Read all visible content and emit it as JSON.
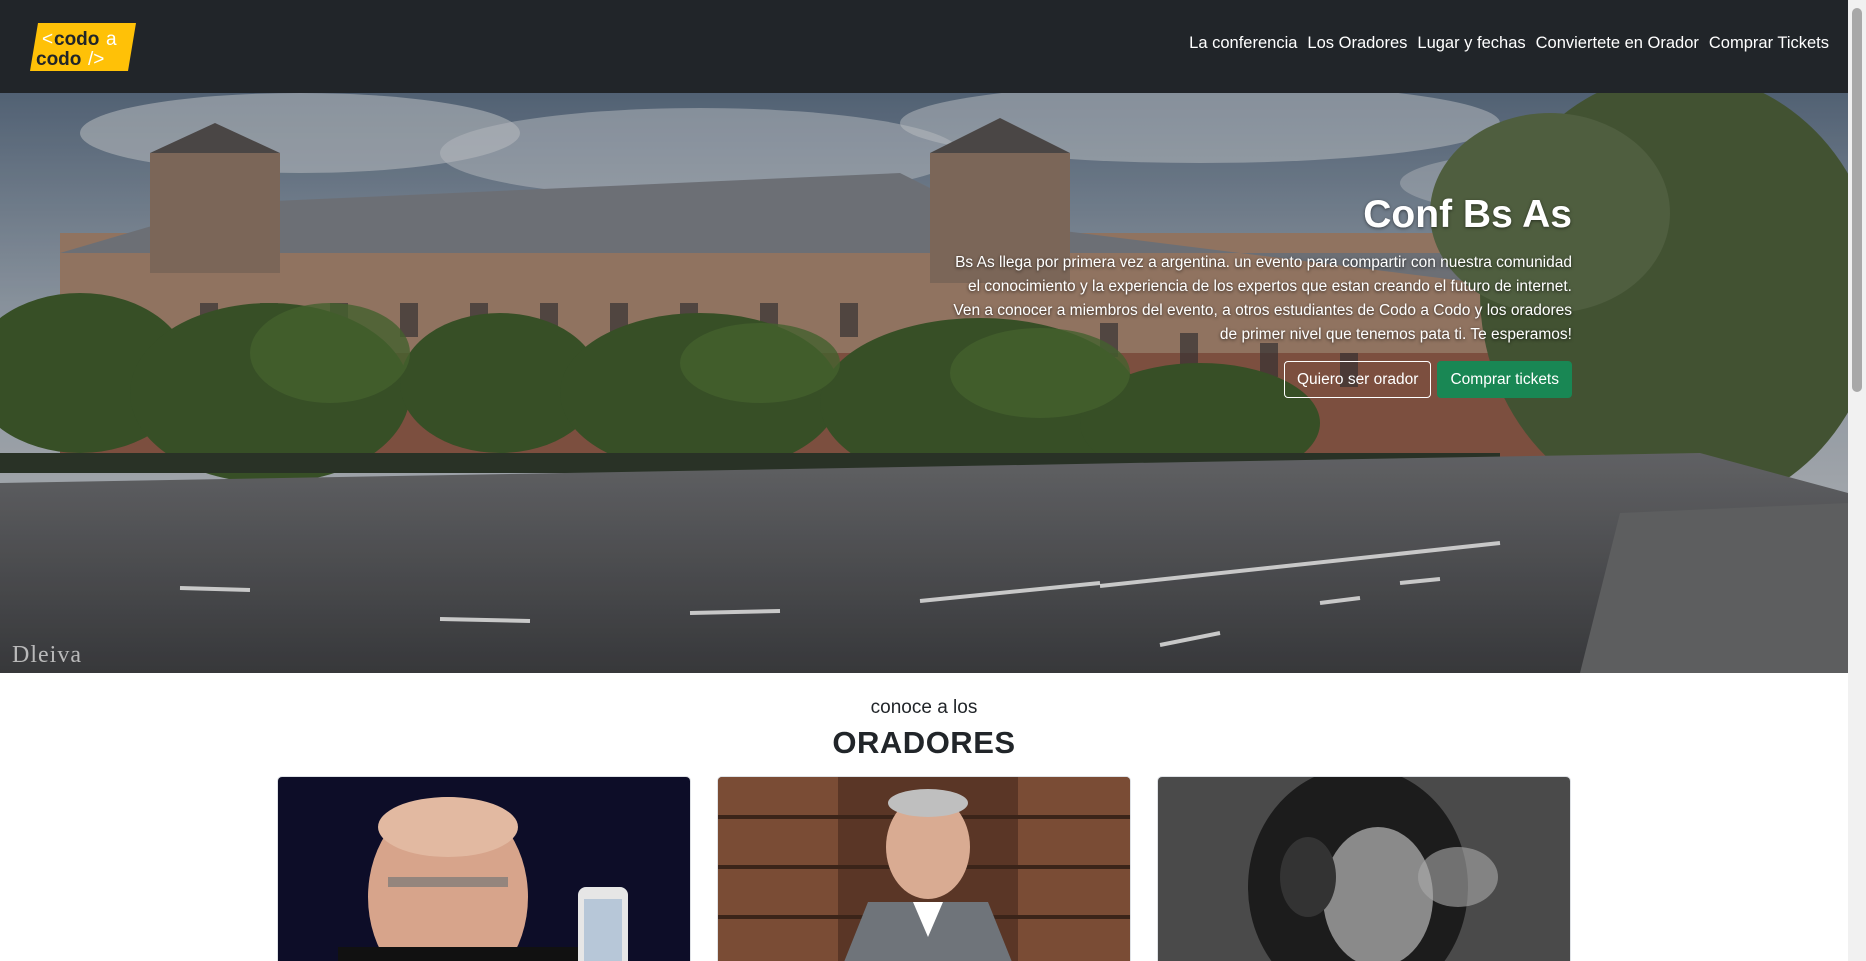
{
  "brand": {
    "logo_text": "codo a codo",
    "logo_line1": "<codo",
    "logo_a": "a",
    "logo_line2": "codo",
    "logo_end": "/>"
  },
  "nav": {
    "items": [
      {
        "label": "La conferencia"
      },
      {
        "label": "Los Oradores"
      },
      {
        "label": "Lugar y fechas"
      },
      {
        "label": "Conviertete en Orador"
      },
      {
        "label": "Comprar Tickets"
      }
    ]
  },
  "hero": {
    "title": "Conf Bs As",
    "lines": [
      "Bs As llega por primera vez a argentina. un evento para compartir con nuestra comunidad",
      "el conocimiento y la experiencia de los expertos que estan creando el futuro de internet.",
      "Ven a conocer a miembros del evento, a otros estudiantes de Codo a Codo y los oradores",
      "de primer nivel que tenemos pata ti. Te esperamos!"
    ],
    "button_speaker": "Quiero ser orador",
    "button_tickets": "Comprar tickets",
    "watermark": "Dleiva"
  },
  "speakers": {
    "subtitle": "conoce a los",
    "title": "ORADORES"
  },
  "colors": {
    "navbar": "#212529",
    "logo_yellow": "#ffc107",
    "success": "#198754"
  }
}
